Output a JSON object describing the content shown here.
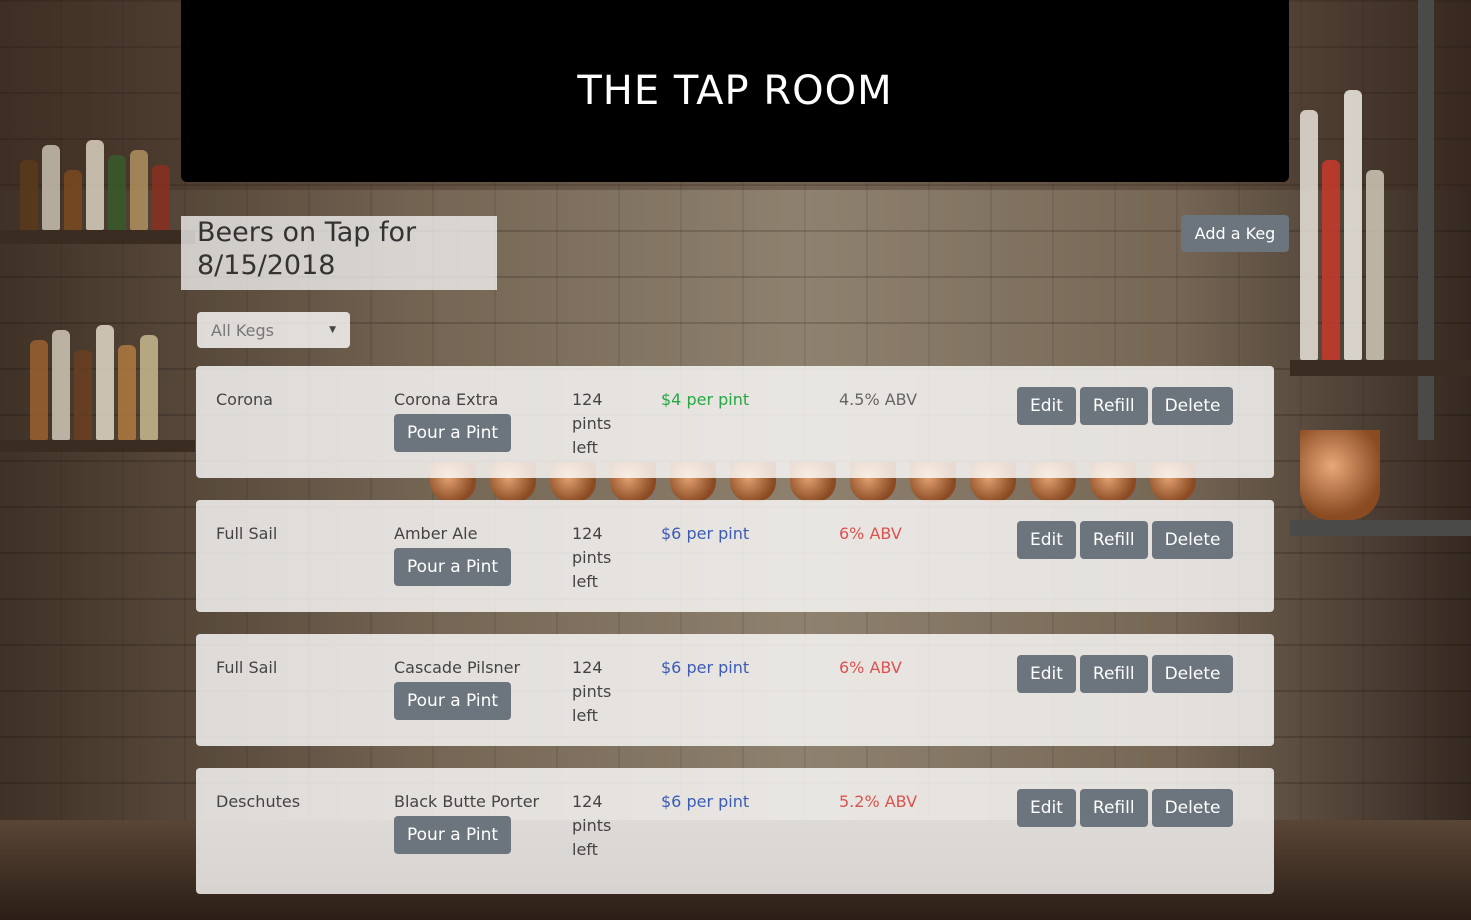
{
  "header": {
    "title": "THE TAP ROOM"
  },
  "page": {
    "heading": "Beers on Tap for 8/15/2018",
    "add_keg_label": "Add a Keg",
    "filter": {
      "selected": "All Kegs"
    }
  },
  "kegs": [
    {
      "brand": "Corona",
      "name": "Corona Extra",
      "pints": "124 pints left",
      "price": "$4 per pint",
      "price_color": "#28a745",
      "abv": "4.5% ABV",
      "abv_color": "#666666",
      "pour_label": "Pour a Pint",
      "edit_label": "Edit",
      "refill_label": "Refill",
      "delete_label": "Delete"
    },
    {
      "brand": "Full Sail",
      "name": "Amber Ale",
      "pints": "124 pints left",
      "price": "$6 per pint",
      "price_color": "#3b5bb5",
      "abv": "6% ABV",
      "abv_color": "#d9534f",
      "pour_label": "Pour a Pint",
      "edit_label": "Edit",
      "refill_label": "Refill",
      "delete_label": "Delete"
    },
    {
      "brand": "Full Sail",
      "name": "Cascade Pilsner",
      "pints": "124 pints left",
      "price": "$6 per pint",
      "price_color": "#3b5bb5",
      "abv": "6% ABV",
      "abv_color": "#d9534f",
      "pour_label": "Pour a Pint",
      "edit_label": "Edit",
      "refill_label": "Refill",
      "delete_label": "Delete"
    },
    {
      "brand": "Deschutes",
      "name": "Black Butte Porter",
      "pints": "124 pints left",
      "price": "$6 per pint",
      "price_color": "#3b5bb5",
      "abv": "5.2% ABV",
      "abv_color": "#d9534f",
      "pour_label": "Pour a Pint",
      "edit_label": "Edit",
      "refill_label": "Refill",
      "delete_label": "Delete"
    }
  ]
}
